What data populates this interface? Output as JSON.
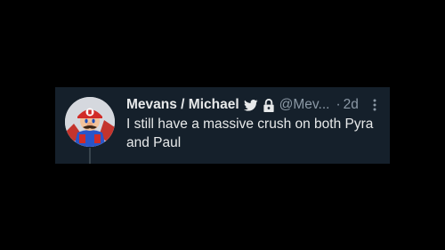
{
  "tweet": {
    "display_name": "Mevans / Michael",
    "handle": "@Mev...",
    "separator": "·",
    "time": "2d",
    "text": "I still have a massive crush on both Pyra and Paul",
    "badges": [
      "twitter-bird-icon",
      "lock-icon"
    ],
    "menu_icon": "more-vertical-icon",
    "avatar_icon": "mario-avatar"
  },
  "colors": {
    "page_background": "#000000",
    "card_background": "#15202b",
    "primary_text": "#e7e9ea",
    "secondary_text": "#8b98a5"
  }
}
